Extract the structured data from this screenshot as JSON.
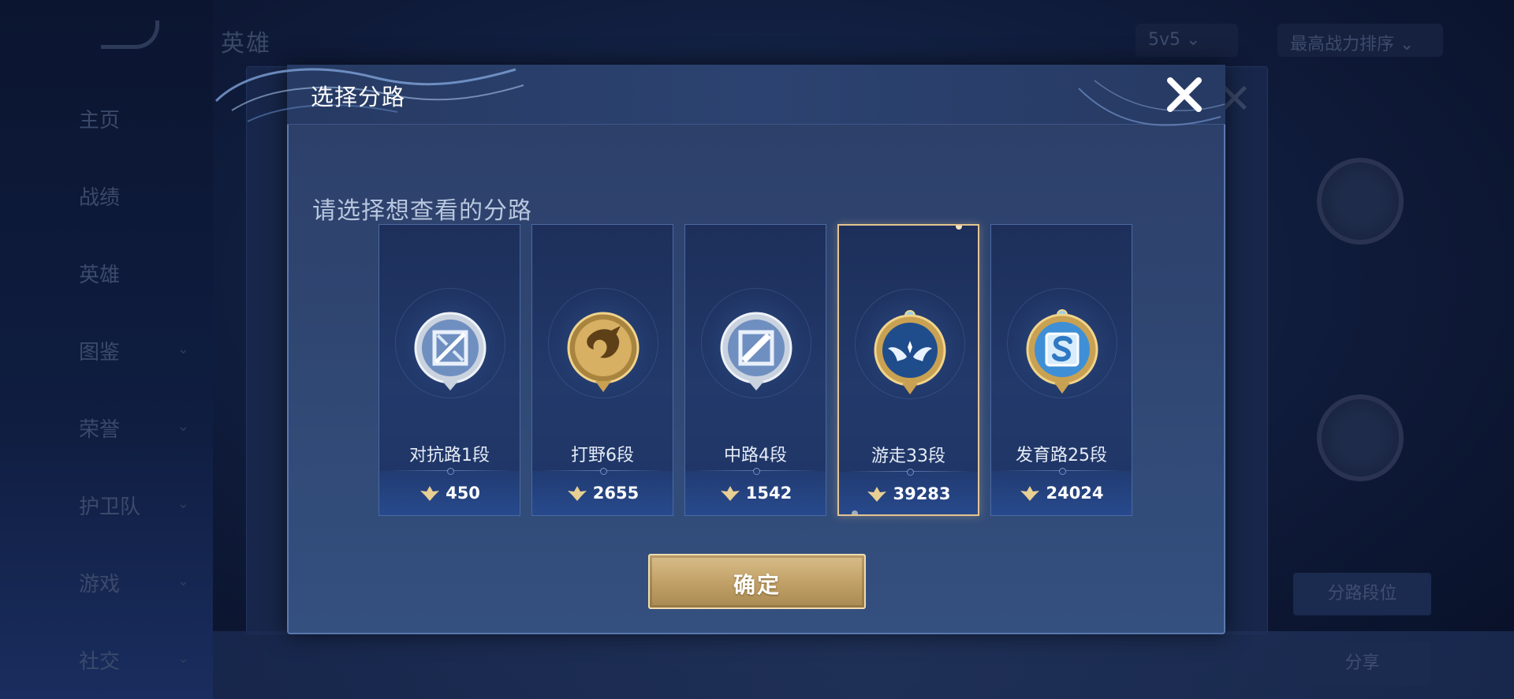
{
  "background": {
    "page_title": "英雄",
    "nav_items": [
      "主页",
      "战绩",
      "英雄",
      "图鉴",
      "荣誉",
      "护卫队",
      "游戏",
      "社交"
    ],
    "mode_select": "5v5",
    "sort_select": "最高战力排序",
    "right_buttons": [
      "分路段位",
      "分享"
    ]
  },
  "modal": {
    "title": "选择分路",
    "prompt": "请选择想查看的分路",
    "confirm_label": "确定",
    "lanes": [
      {
        "name": "对抗路1段",
        "points": "450",
        "emblem": "clash-lane-emblem",
        "tier": "silver",
        "selected": false
      },
      {
        "name": "打野6段",
        "points": "2655",
        "emblem": "jungle-dragon-emblem",
        "tier": "gold",
        "selected": false
      },
      {
        "name": "中路4段",
        "points": "1542",
        "emblem": "mid-lane-emblem",
        "tier": "silver",
        "selected": false
      },
      {
        "name": "游走33段",
        "points": "39283",
        "emblem": "roam-wings-emblem",
        "tier": "gold-blue",
        "selected": true
      },
      {
        "name": "发育路25段",
        "points": "24024",
        "emblem": "farm-lane-emblem",
        "tier": "gold-blue",
        "selected": false
      }
    ]
  },
  "colors": {
    "modal_bg": "#2f4570",
    "card_border": "#4a6aa4",
    "selected_border": "#e5c491",
    "confirm_gold": "#c2a268"
  }
}
